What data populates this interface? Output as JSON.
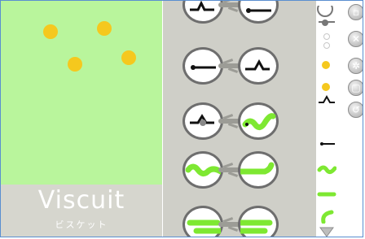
{
  "app": {
    "title": "Viscuit",
    "subtitle": "ビスケット"
  },
  "colors": {
    "stage_bg": "#b9f59c",
    "part_yellow": "#f5c81e",
    "part_green": "#7ee832",
    "panel_bg": "#cfcfc8",
    "brand_bg": "#d6d6ce"
  },
  "stage": {
    "parts": [
      "yellow-dot",
      "yellow-dot",
      "yellow-dot",
      "yellow-dot"
    ]
  },
  "rules": [
    {
      "left": "black-wave",
      "right": "black-line"
    },
    {
      "left": "black-line",
      "right": "black-wave"
    },
    {
      "left": "black-wave-gray",
      "right": "green-worm"
    },
    {
      "left": "green-worm-pair",
      "right": "green-worm-pair"
    },
    {
      "left": "green-worm-pair",
      "right": "green-worm-pair"
    }
  ],
  "tools": {
    "stop": {
      "icon": "stop-icon"
    },
    "close": {
      "icon": "close-icon"
    },
    "settings": {
      "icon": "gear-icon"
    },
    "new": {
      "icon": "square-icon"
    },
    "undo": {
      "icon": "undo-icon"
    }
  },
  "palette": [
    "glasses-part",
    "mini-dots",
    "yellow-dot",
    "yellow-dot",
    "black-wave",
    "black-line",
    "green-worm",
    "green-worm",
    "green-worm-partial",
    "triangle"
  ]
}
